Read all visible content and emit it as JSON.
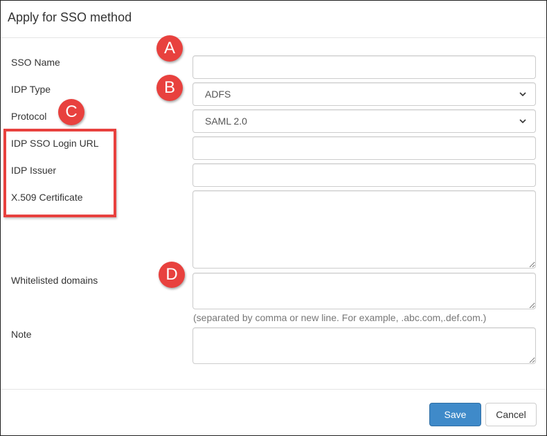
{
  "dialog": {
    "title": "Apply for SSO method"
  },
  "fields": {
    "sso_name": {
      "label": "SSO Name",
      "value": ""
    },
    "idp_type": {
      "label": "IDP Type",
      "value": "ADFS"
    },
    "protocol": {
      "label": "Protocol",
      "value": "SAML 2.0"
    },
    "idp_sso_login_url": {
      "label": "IDP SSO Login URL",
      "value": ""
    },
    "idp_issuer": {
      "label": "IDP Issuer",
      "value": ""
    },
    "x509_certificate": {
      "label": "X.509 Certificate",
      "value": ""
    },
    "whitelisted_domains": {
      "label": "Whitelisted domains",
      "value": "",
      "help": "(separated by comma or new line. For example, .abc.com,.def.com.)"
    },
    "note": {
      "label": "Note",
      "value": ""
    }
  },
  "footer": {
    "save_label": "Save",
    "cancel_label": "Cancel"
  },
  "annotations": {
    "a": "A",
    "b": "B",
    "c": "C",
    "d": "D"
  },
  "colors": {
    "primary": "#3f8ac9",
    "annotation": "#e8413e",
    "help_text": "#777777"
  },
  "icons": {
    "select_arrow": "chevron-down-icon"
  }
}
